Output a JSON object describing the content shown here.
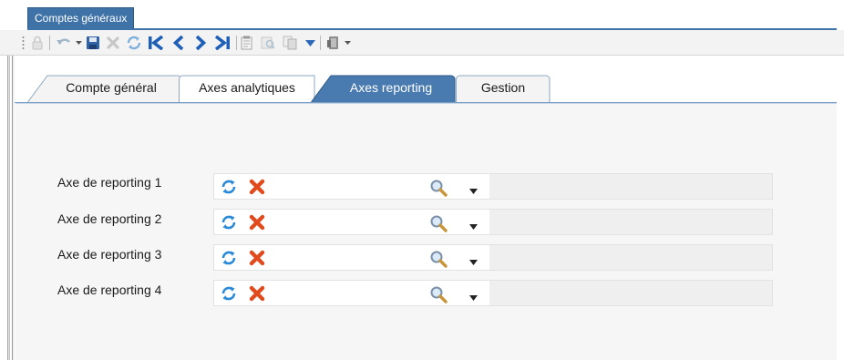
{
  "document_tab": {
    "title": "Comptes généraux"
  },
  "toolbar": {
    "items": [
      "lock-icon",
      "undo-icon",
      "save-icon",
      "delete-icon",
      "refresh-icon",
      "first-record-icon",
      "previous-record-icon",
      "next-record-icon",
      "last-record-icon",
      "notes-icon",
      "preview-icon",
      "copy-icon",
      "dropdown-icon",
      "actions-icon"
    ]
  },
  "tabs": [
    {
      "label": "Compte général",
      "active": false
    },
    {
      "label": "Axes analytiques",
      "active": false
    },
    {
      "label": "Axes reporting",
      "active": true
    },
    {
      "label": "Gestion",
      "active": false
    }
  ],
  "reporting": {
    "rows": [
      {
        "label": "Axe de reporting 1",
        "value": ""
      },
      {
        "label": "Axe de reporting 2",
        "value": ""
      },
      {
        "label": "Axe de reporting 3",
        "value": ""
      },
      {
        "label": "Axe de reporting 4",
        "value": ""
      }
    ]
  },
  "colors": {
    "accent": "#3f73a8",
    "delete": "#e04a1c",
    "refresh": "#3a8fd6"
  }
}
